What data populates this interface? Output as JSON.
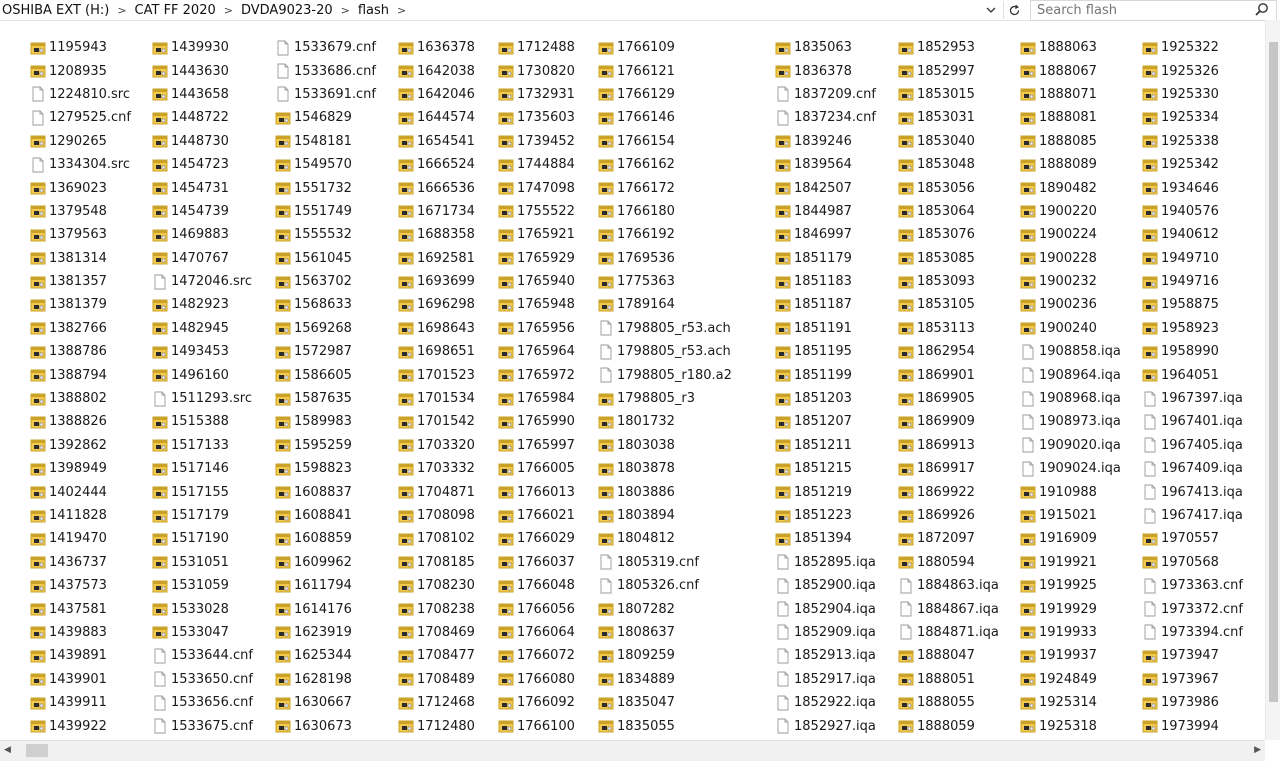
{
  "address": {
    "crumbs": [
      "OSHIBA EXT (H:)",
      "CAT FF 2020",
      "DVDA9023-20",
      "flash"
    ],
    "separator": ">"
  },
  "search": {
    "placeholder": "Search flash"
  },
  "columns": [
    [
      "1195943",
      "1208935",
      "1224810.src",
      "1279525.cnf",
      "1290265",
      "1334304.src",
      "1369023",
      "1379548",
      "1379563",
      "1381314",
      "1381357",
      "1381379",
      "1382766",
      "1388786",
      "1388794",
      "1388802",
      "1388826",
      "1392862",
      "1398949",
      "1402444",
      "1411828",
      "1419470",
      "1436737",
      "1437573",
      "1437581",
      "1439883",
      "1439891",
      "1439901",
      "1439911",
      "1439922"
    ],
    [
      "1439930",
      "1443630",
      "1443658",
      "1448722",
      "1448730",
      "1454723",
      "1454731",
      "1454739",
      "1469883",
      "1470767",
      "1472046.src",
      "1482923",
      "1482945",
      "1493453",
      "1496160",
      "1511293.src",
      "1515388",
      "1517133",
      "1517146",
      "1517155",
      "1517179",
      "1517190",
      "1531051",
      "1531059",
      "1533028",
      "1533047",
      "1533644.cnf",
      "1533650.cnf",
      "1533656.cnf",
      "1533675.cnf"
    ],
    [
      "1533679.cnf",
      "1533686.cnf",
      "1533691.cnf",
      "1546829",
      "1548181",
      "1549570",
      "1551732",
      "1551749",
      "1555532",
      "1561045",
      "1563702",
      "1568633",
      "1569268",
      "1572987",
      "1586605",
      "1587635",
      "1589983",
      "1595259",
      "1598823",
      "1608837",
      "1608841",
      "1608859",
      "1609962",
      "1611794",
      "1614176",
      "1623919",
      "1625344",
      "1628198",
      "1630667",
      "1630673"
    ],
    [
      "1636378",
      "1642038",
      "1642046",
      "1644574",
      "1654541",
      "1666524",
      "1666536",
      "1671734",
      "1688358",
      "1692581",
      "1693699",
      "1696298",
      "1698643",
      "1698651",
      "1701523",
      "1701534",
      "1701542",
      "1703320",
      "1703332",
      "1704871",
      "1708098",
      "1708102",
      "1708185",
      "1708230",
      "1708238",
      "1708469",
      "1708477",
      "1708489",
      "1712468",
      "1712480"
    ],
    [
      "1712488",
      "1730820",
      "1732931",
      "1735603",
      "1739452",
      "1744884",
      "1747098",
      "1755522",
      "1765921",
      "1765929",
      "1765940",
      "1765948",
      "1765956",
      "1765964",
      "1765972",
      "1765984",
      "1765990",
      "1765997",
      "1766005",
      "1766013",
      "1766021",
      "1766029",
      "1766037",
      "1766048",
      "1766056",
      "1766064",
      "1766072",
      "1766080",
      "1766092",
      "1766100"
    ],
    [
      "1766109",
      "1766121",
      "1766129",
      "1766146",
      "1766154",
      "1766162",
      "1766172",
      "1766180",
      "1766192",
      "1769536",
      "1775363",
      "1789164",
      "1798805_r53.ach",
      "1798805_r53.ach",
      "1798805_r180.a2",
      "1798805_r3",
      "1801732",
      "1803038",
      "1803878",
      "1803886",
      "1803894",
      "1804812",
      "1805319.cnf",
      "1805326.cnf",
      "1807282",
      "1808637",
      "1809259",
      "1834889",
      "1835047",
      "1835055"
    ],
    [
      "1835063",
      "1836378",
      "1837209.cnf",
      "1837234.cnf",
      "1839246",
      "1839564",
      "1842507",
      "1844987",
      "1846997",
      "1851179",
      "1851183",
      "1851187",
      "1851191",
      "1851195",
      "1851199",
      "1851203",
      "1851207",
      "1851211",
      "1851215",
      "1851219",
      "1851223",
      "1851394",
      "1852895.iqa",
      "1852900.iqa",
      "1852904.iqa",
      "1852909.iqa",
      "1852913.iqa",
      "1852917.iqa",
      "1852922.iqa",
      "1852927.iqa"
    ],
    [
      "1852953",
      "1852997",
      "1853015",
      "1853031",
      "1853040",
      "1853048",
      "1853056",
      "1853064",
      "1853076",
      "1853085",
      "1853093",
      "1853105",
      "1853113",
      "1862954",
      "1869901",
      "1869905",
      "1869909",
      "1869913",
      "1869917",
      "1869922",
      "1869926",
      "1872097",
      "1880594",
      "1884863.iqa",
      "1884867.iqa",
      "1884871.iqa",
      "1888047",
      "1888051",
      "1888055",
      "1888059"
    ],
    [
      "1888063",
      "1888067",
      "1888071",
      "1888081",
      "1888085",
      "1888089",
      "1890482",
      "1900220",
      "1900224",
      "1900228",
      "1900232",
      "1900236",
      "1900240",
      "1908858.iqa",
      "1908964.iqa",
      "1908968.iqa",
      "1908973.iqa",
      "1909020.iqa",
      "1909024.iqa",
      "1910988",
      "1915021",
      "1916909",
      "1919921",
      "1919925",
      "1919929",
      "1919933",
      "1919937",
      "1924849",
      "1925314",
      "1925318"
    ],
    [
      "1925322",
      "1925326",
      "1925330",
      "1925334",
      "1925338",
      "1925342",
      "1934646",
      "1940576",
      "1940612",
      "1949710",
      "1949716",
      "1958875",
      "1958923",
      "1958990",
      "1964051",
      "1967397.iqa",
      "1967401.iqa",
      "1967405.iqa",
      "1967409.iqa",
      "1967413.iqa",
      "1967417.iqa",
      "1970557",
      "1970568",
      "1973363.cnf",
      "1973372.cnf",
      "1973394.cnf",
      "1973947",
      "1973967",
      "1973986",
      "1973994"
    ]
  ],
  "colors": {
    "folder_body": "#f2c94c",
    "folder_shade": "#c9a227",
    "doc_sheet": "#ffffff"
  },
  "icons": {
    "executable_file": "exe-app-icon",
    "plain_file": "blank-document-icon"
  }
}
